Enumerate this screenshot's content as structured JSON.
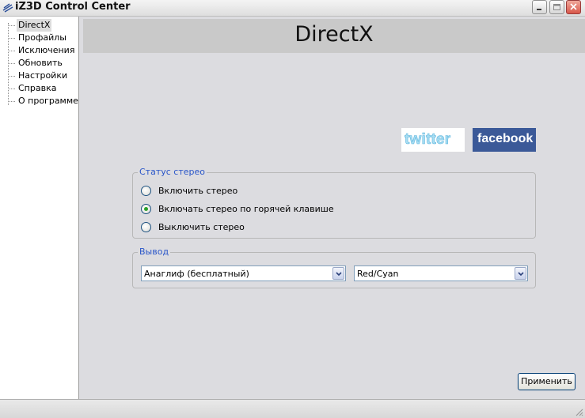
{
  "window": {
    "title": "iZ3D Control Center",
    "icon": "iz3d-app-icon",
    "controls": [
      "minimize",
      "maximize",
      "close"
    ]
  },
  "sidebar": {
    "items": [
      {
        "label": "DirectX",
        "selected": true
      },
      {
        "label": "Профайлы",
        "selected": false
      },
      {
        "label": "Исключения",
        "selected": false
      },
      {
        "label": "Обновить",
        "selected": false
      },
      {
        "label": "Настройки",
        "selected": false
      },
      {
        "label": "Справка",
        "selected": false
      },
      {
        "label": "О программе",
        "selected": false
      }
    ]
  },
  "main": {
    "title": "DirectX",
    "social": {
      "twitter_label": "twitter",
      "facebook_label": "facebook"
    },
    "stereo_group": {
      "legend": "Статус стерео",
      "options": [
        {
          "label": "Включить стерео",
          "checked": false
        },
        {
          "label": "Включать стерео по горячей клавише",
          "checked": true
        },
        {
          "label": "Выключить стерео",
          "checked": false
        }
      ]
    },
    "output_group": {
      "legend": "Вывод",
      "output_mode": "Анаглиф (бесплатный)",
      "color_mode": "Red/Cyan"
    },
    "apply_label": "Применить"
  },
  "colors": {
    "legend_text": "#2a56c9",
    "radio_checked": "#2aa02a",
    "facebook_bg": "#3b5998",
    "twitter_text": "#a9def3"
  }
}
